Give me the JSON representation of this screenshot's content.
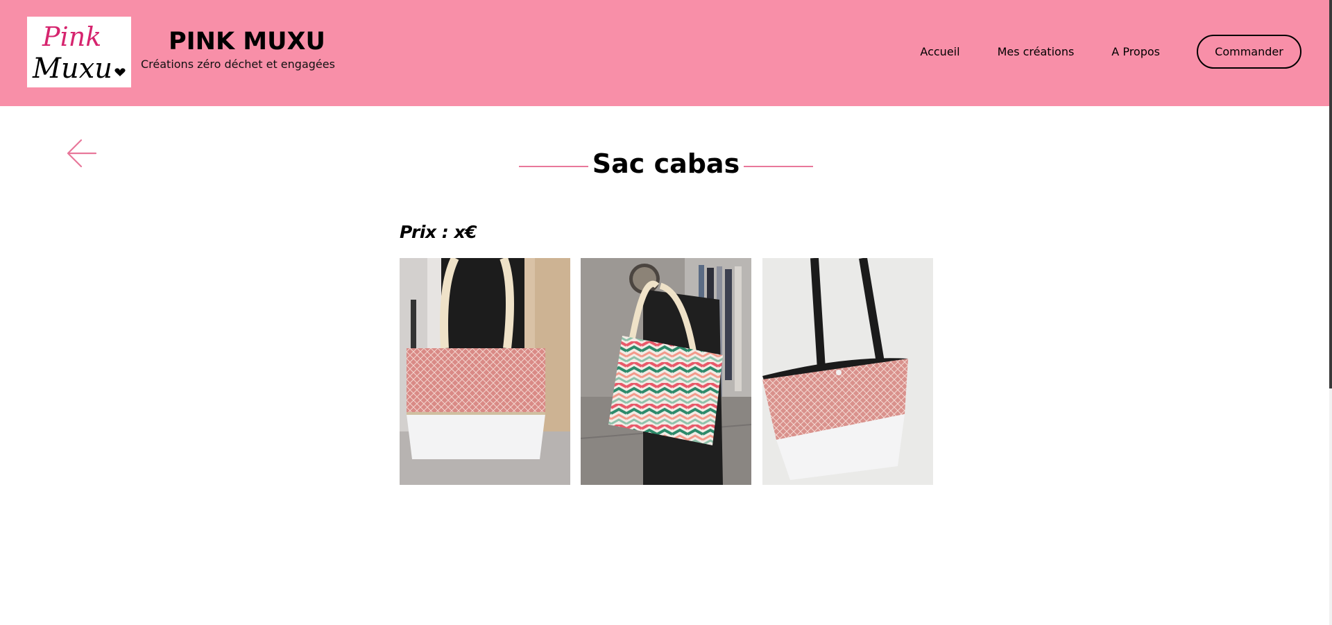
{
  "header": {
    "logo": {
      "line1": "Pink",
      "line2": "Muxu"
    },
    "brand_name": "PINK MUXU",
    "tagline": "Créations zéro déchet et engagées",
    "background_color": "#f88fa8"
  },
  "nav": {
    "items": [
      {
        "label": "Accueil"
      },
      {
        "label": "Mes créations"
      },
      {
        "label": "A Propos"
      }
    ],
    "order_button": "Commander"
  },
  "product": {
    "back_icon": "arrow-left-icon",
    "title": "Sac cabas",
    "price": "Prix : x€",
    "accent_color": "#e8779a",
    "photos": [
      {
        "subject": "tote bag with pink diamond-pattern top and white bottom, cream handles"
      },
      {
        "subject": "tote bag with pink, green and white chevron pattern on a black chair"
      },
      {
        "subject": "tote bag with pink diamond-pattern top, white bottom and black handles"
      }
    ]
  }
}
